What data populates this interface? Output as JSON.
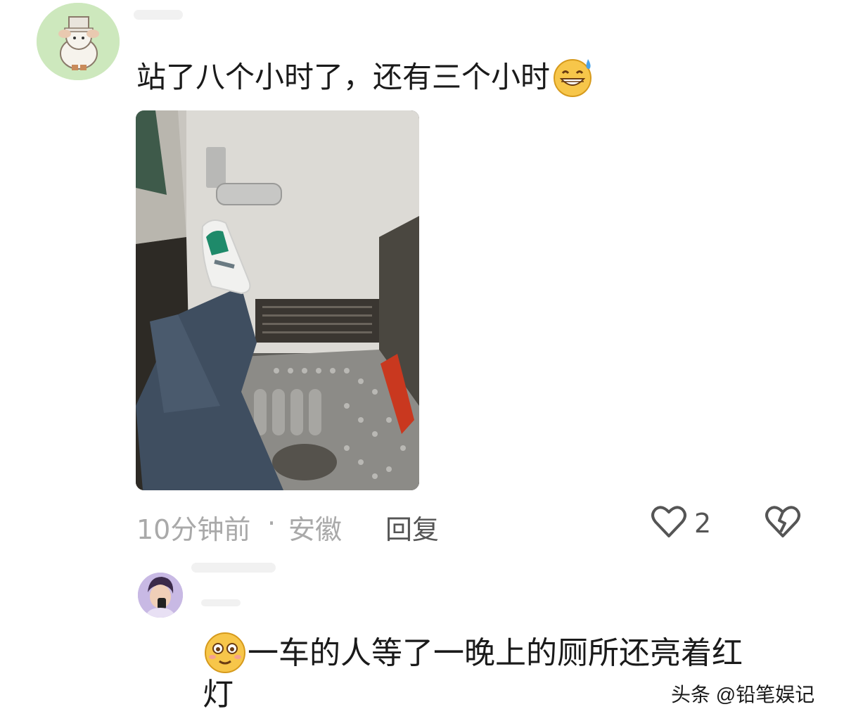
{
  "comment1": {
    "text": "站了八个小时了，还有三个小时",
    "emoji": "grinning-sweat-emoji",
    "time": "10分钟前",
    "separator": "·",
    "location": "安徽",
    "reply_label": "回复",
    "like_count": "2"
  },
  "comment2": {
    "emoji": "flushed-smile-emoji",
    "line1": "一车的人等了一晚上的厕所还亮着红",
    "line2": "灯"
  },
  "watermark": "头条 @铅笔娱记",
  "icons": {
    "like": "heart-outline-icon",
    "dislike": "broken-heart-icon"
  },
  "colors": {
    "text": "#1a1a1a",
    "meta": "#a9a9a9",
    "emoji_yellow": "#f7c64a"
  }
}
